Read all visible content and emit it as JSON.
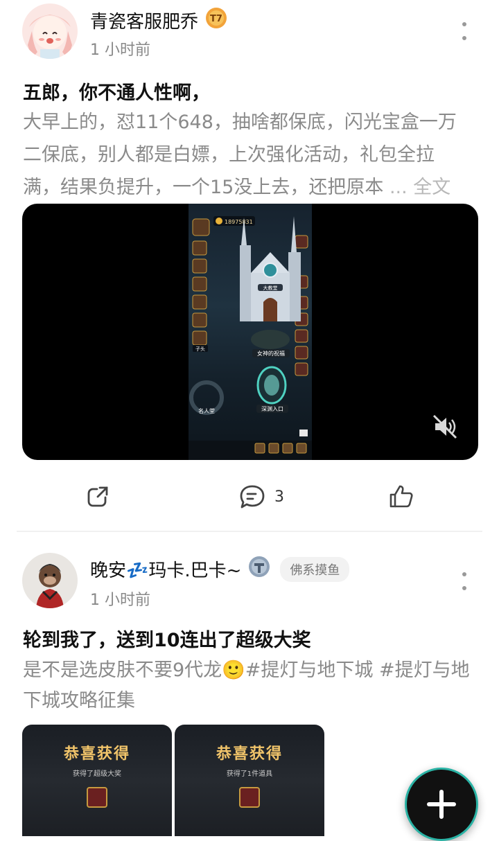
{
  "posts": [
    {
      "author": "青瓷客服肥乔",
      "time": "1 小时前",
      "level_badge": "T7",
      "title": "五郎，你不通人性啊，",
      "body_lines": [
        "大早上的，怼11个648，抽啥都保底，闪光宝盒一万",
        "二保底，别人都是白嫖，上次强化活动，礼包全拉",
        "满，结果负提升，一个15没上去，还把原本 "
      ],
      "more_text": "... 全文",
      "video": {
        "gold_count": "18975831",
        "labels": [
          "大教堂",
          "女神的祝福",
          "深渊入口",
          "名人堂",
          "子头"
        ]
      },
      "actions": {
        "share_count": "",
        "comment_count": "3",
        "like_count": ""
      }
    },
    {
      "author": "晚安💤玛卡.巴卡~",
      "time": "1 小时前",
      "tag": "佛系摸鱼",
      "title": "轮到我了，送到10连出了超级大奖",
      "body_line1": "是不是选皮肤不要9代龙🙂#提灯与地下城 #提灯与地",
      "body_line2": "下城攻略征集",
      "images": [
        {
          "title": "恭喜获得",
          "subtitle": "获得了超级大奖"
        },
        {
          "title": "恭喜获得",
          "subtitle": "获得了1件道具"
        }
      ]
    }
  ],
  "colors": {
    "accent_orange": "#e8823a",
    "fab_ring": "#2ab3a5",
    "muted_text": "#8a8a8a"
  }
}
